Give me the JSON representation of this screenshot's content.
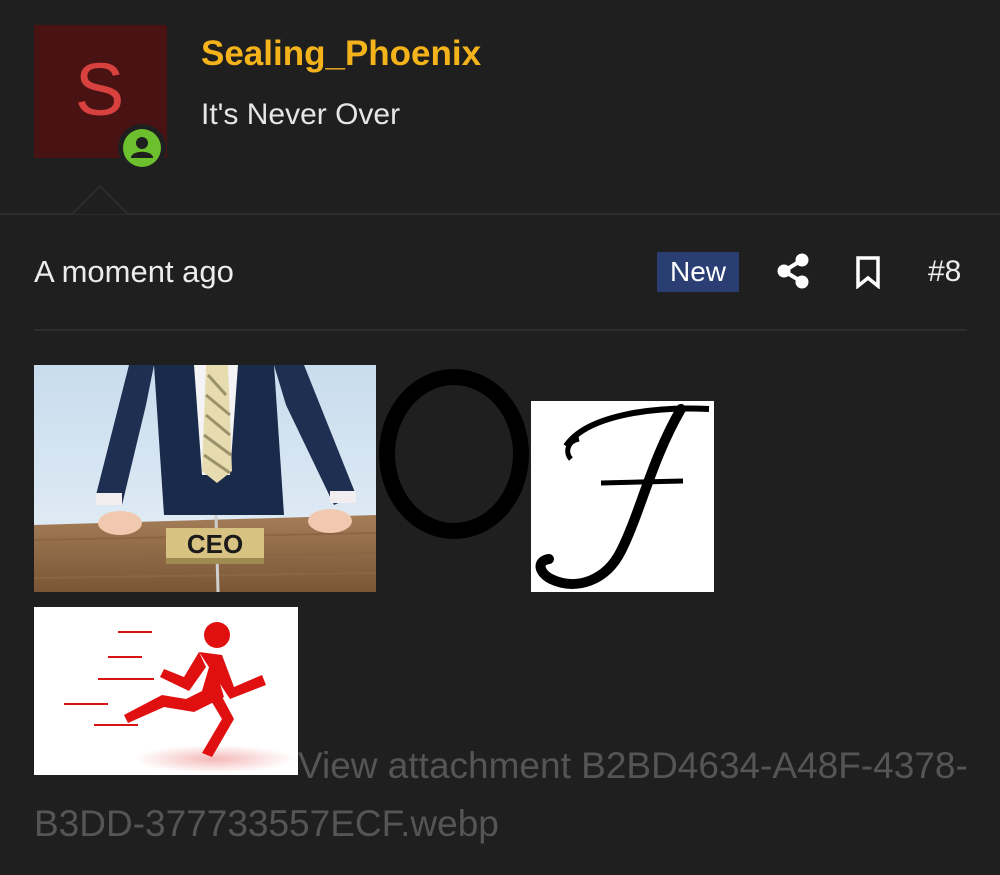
{
  "author": {
    "avatar_letter": "S",
    "avatar_bg": "#4a1313",
    "avatar_fg": "#d9413f",
    "username": "Sealing_Phoenix",
    "username_color": "#f4b31b",
    "user_title": "It's Never Over",
    "status_icon": "online-user-icon",
    "status_color": "#6cbf2d"
  },
  "post_meta": {
    "timestamp": "A moment ago",
    "new_label": "New",
    "new_badge_color": "#2a3e74",
    "share_icon": "share-icon",
    "bookmark_icon": "bookmark-icon",
    "post_number": "#8"
  },
  "message": {
    "image_ceo_sign_text": "CEO",
    "letter_o": "O",
    "letter_f": "ƒ",
    "attachment_link_text": "View attachment B2BD4634-A48F-4378-B3DD-377733557ECF.webp"
  }
}
